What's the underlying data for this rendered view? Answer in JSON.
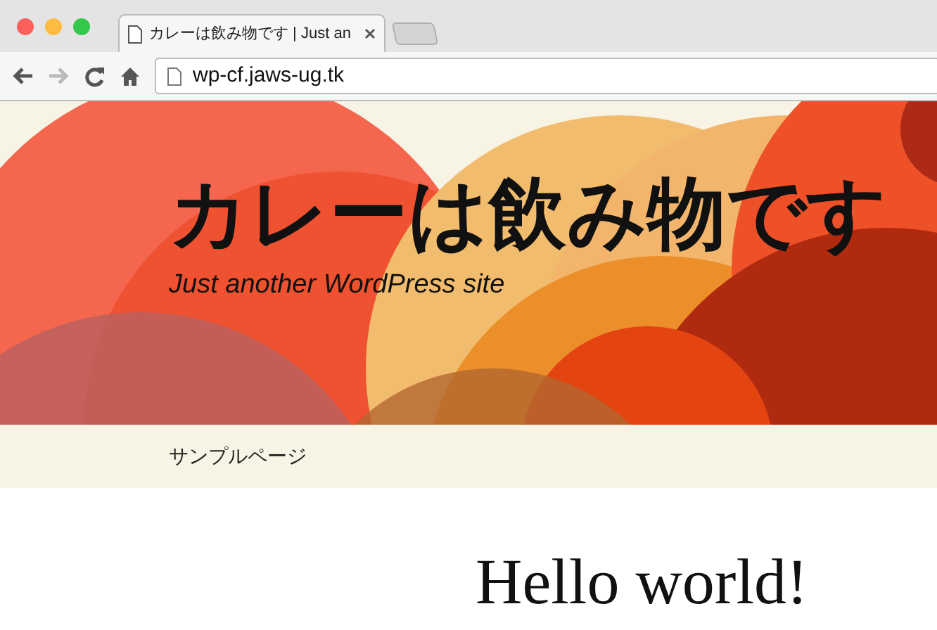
{
  "window": {
    "tab_title": "カレーは飲み物です | Just an",
    "address": "wp-cf.jaws-ug.tk"
  },
  "site": {
    "title": "カレーは飲み物です",
    "tagline": "Just another WordPress site"
  },
  "nav": {
    "items": [
      "サンプルページ"
    ]
  },
  "post": {
    "title": "Hello world!"
  }
}
